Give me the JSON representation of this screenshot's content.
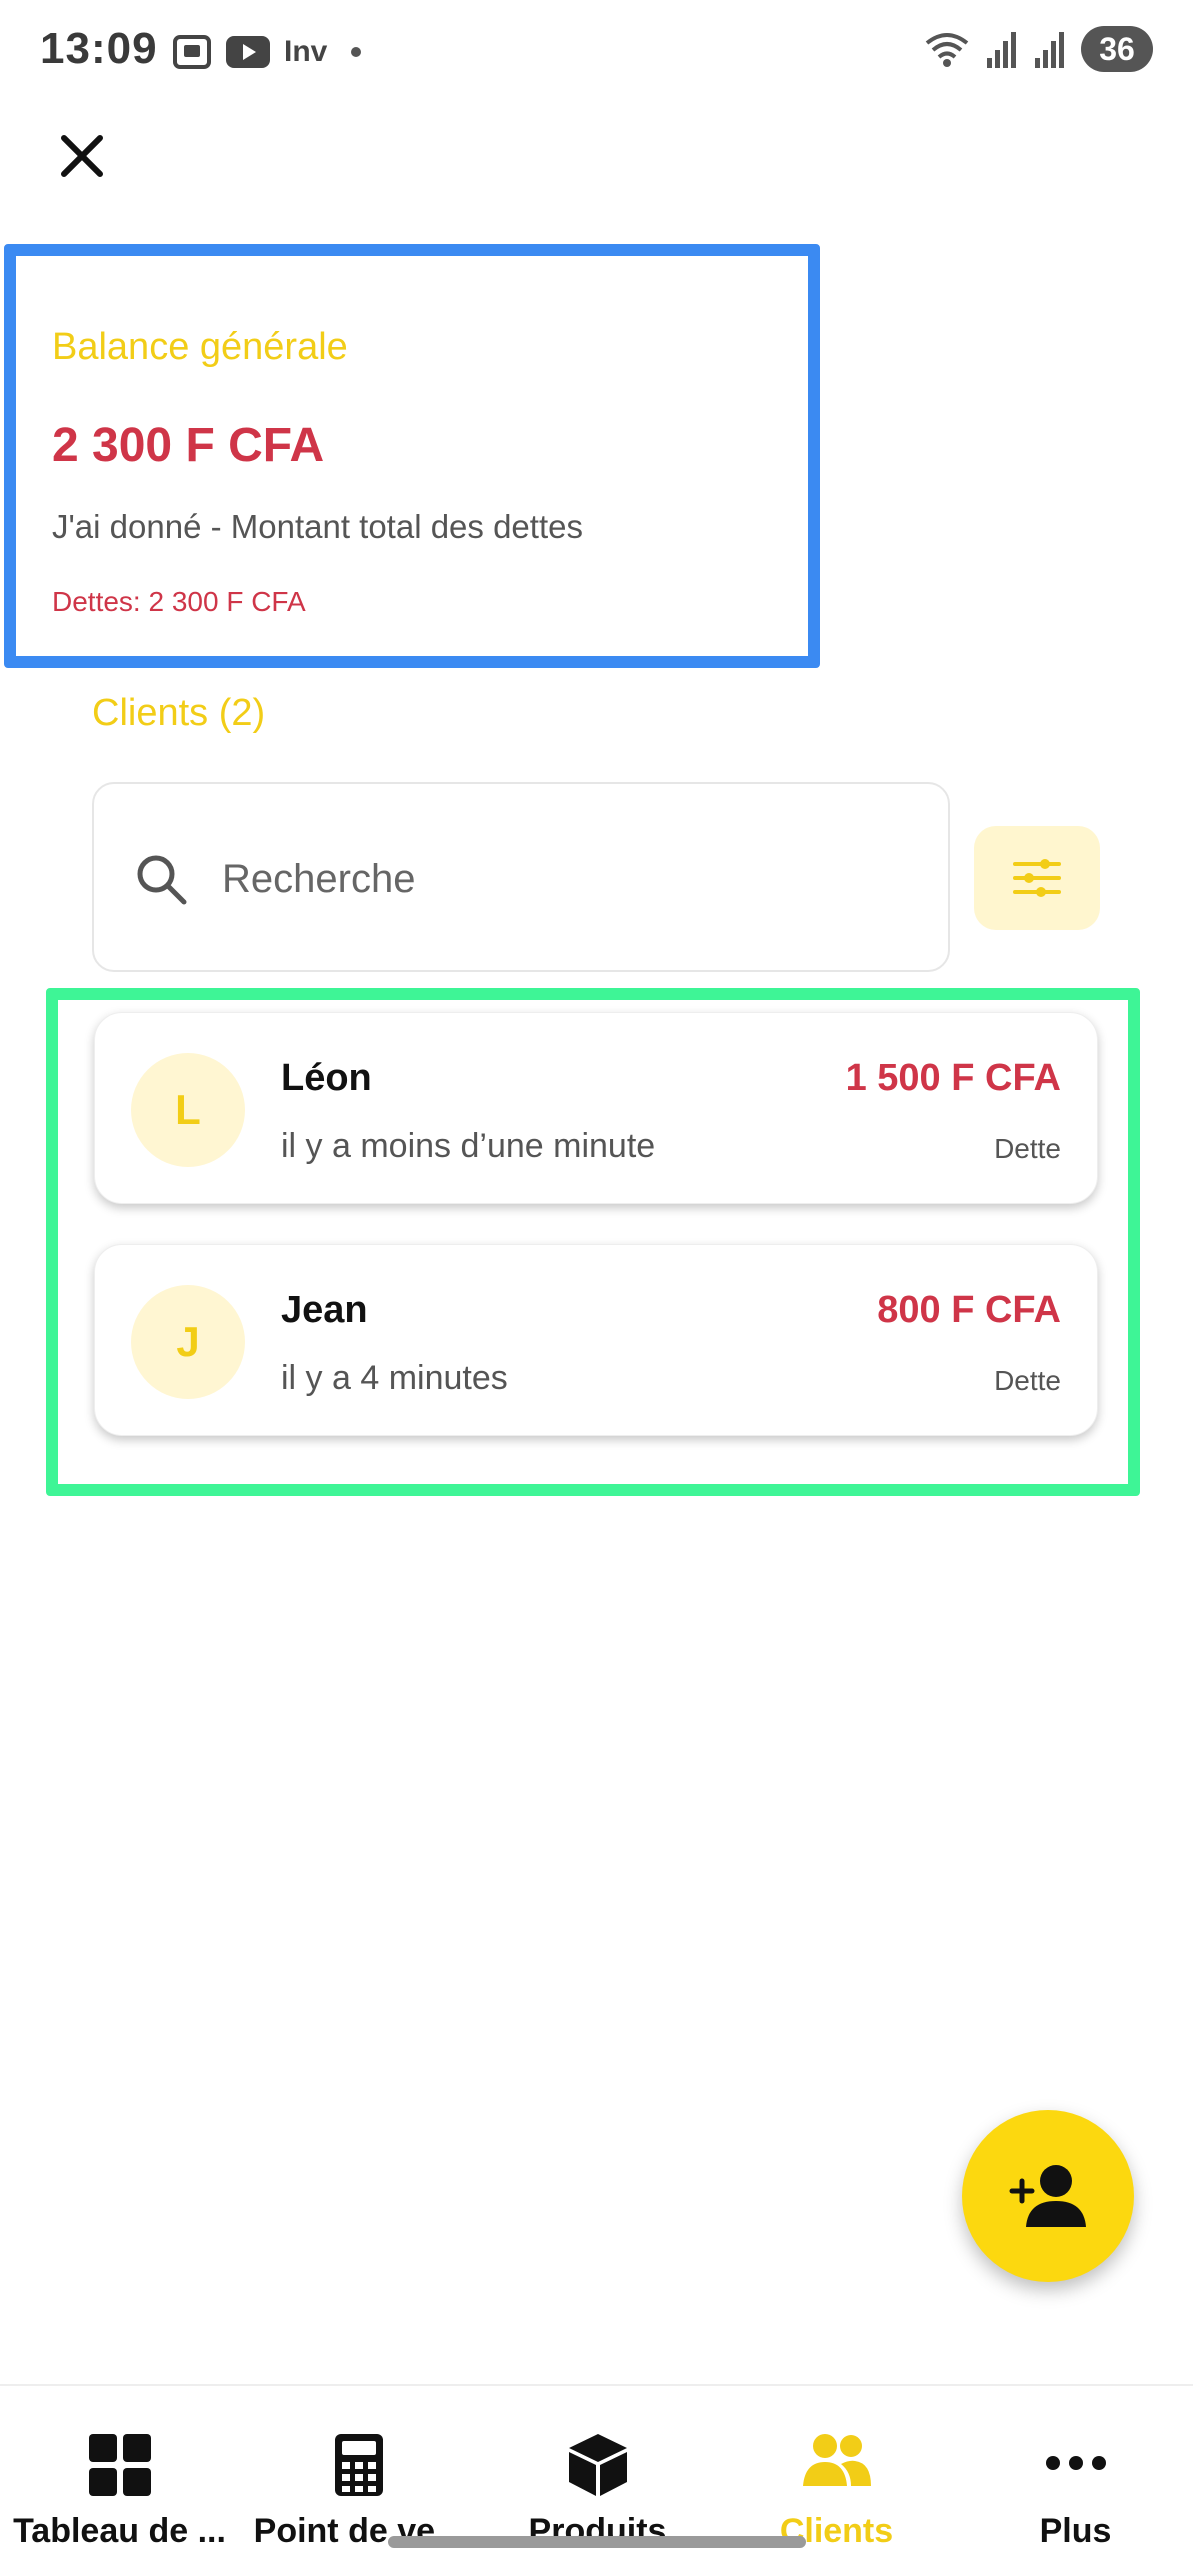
{
  "status_bar": {
    "time": "13:09",
    "inv_label": "Inv",
    "battery": "36",
    "wifi_badge": "5"
  },
  "balance": {
    "title": "Balance générale",
    "amount": "2 300 F CFA",
    "description": "J'ai donné - Montant total des dettes",
    "debts": "Dettes: 2 300 F CFA"
  },
  "clients": {
    "heading": "Clients (2)",
    "search_placeholder": "Recherche",
    "items": [
      {
        "initial": "L",
        "name": "Léon",
        "time": "il y a moins d’une minute",
        "amount": "1 500 F CFA",
        "type": "Dette"
      },
      {
        "initial": "J",
        "name": "Jean",
        "time": "il y a 4 minutes",
        "amount": "800 F CFA",
        "type": "Dette"
      }
    ]
  },
  "nav": {
    "items": [
      {
        "label": "Tableau de ...",
        "icon": "dashboard-grid-icon"
      },
      {
        "label": "Point de ve...",
        "icon": "calculator-icon"
      },
      {
        "label": "Produits",
        "icon": "box-icon"
      },
      {
        "label": "Clients",
        "icon": "users-icon",
        "active": true
      },
      {
        "label": "Plus",
        "icon": "more-dots-icon"
      }
    ]
  },
  "colors": {
    "accent_yellow": "#f2cd17",
    "fab_yellow": "#fcd80f",
    "debt_red": "#cf3548",
    "highlight_blue": "#3b8af2",
    "highlight_green": "#3ef596"
  }
}
